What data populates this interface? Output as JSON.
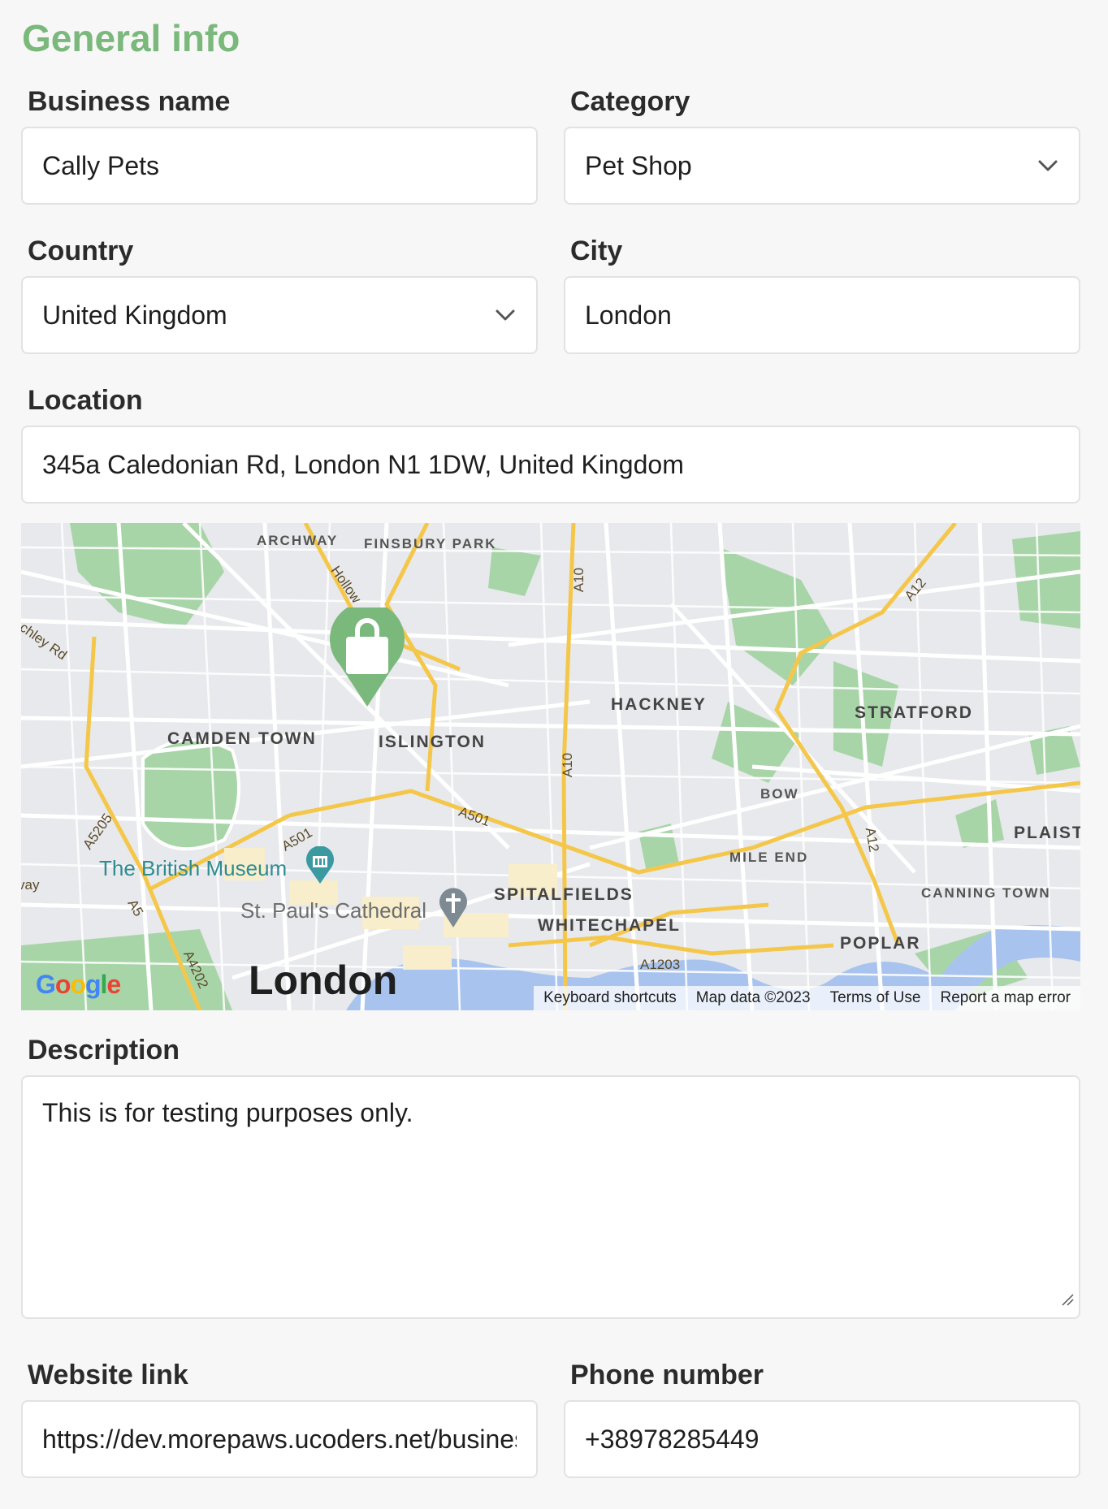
{
  "section_title": "General info",
  "business_name": {
    "label": "Business name",
    "value": "Cally Pets"
  },
  "category": {
    "label": "Category",
    "value": "Pet Shop"
  },
  "country": {
    "label": "Country",
    "value": "United Kingdom"
  },
  "city": {
    "label": "City",
    "value": "London"
  },
  "location": {
    "label": "Location",
    "value": "345a Caledonian Rd, London N1 1DW, United Kingdom"
  },
  "map": {
    "areas": {
      "archway": "ARCHWAY",
      "finsbury_park": "FINSBURY PARK",
      "hackney": "HACKNEY",
      "stratford": "STRATFORD",
      "camden_town": "CAMDEN TOWN",
      "islington": "ISLINGTON",
      "bow": "BOW",
      "plaistow": "PLAIST",
      "mile_end": "MILE END",
      "spitalfields": "SPITALFIELDS",
      "whitechapel": "WHITECHAPEL",
      "canning_town": "CANNING TOWN",
      "poplar": "POPLAR"
    },
    "roads": {
      "a10_north": "A10",
      "a10_south": "A10",
      "a12": "A12",
      "a501_east": "A501",
      "a501_west": "A501",
      "a5205": "A5205",
      "a5": "A5",
      "a4202": "A4202",
      "a1203": "A1203",
      "a12_south": "A12",
      "holloway": "Hollow",
      "chley_rd": "chley Rd",
      "way": "vay"
    },
    "pois": {
      "british_museum": "The British Museum",
      "st_pauls": "St. Paul's Cathedral"
    },
    "city_label": "London",
    "google_logo": "Google",
    "attribution": {
      "shortcuts": "Keyboard shortcuts",
      "map_data": "Map data ©2023",
      "terms": "Terms of Use",
      "report": "Report a map error"
    },
    "marker_icon": "shopping-bag-icon",
    "accent_color": "#7ab87c"
  },
  "description": {
    "label": "Description",
    "value": "This is for testing purposes only."
  },
  "website": {
    "label": "Website link",
    "value": "https://dev.morepaws.ucoders.net/business"
  },
  "phone": {
    "label": "Phone number",
    "value": "+38978285449"
  }
}
